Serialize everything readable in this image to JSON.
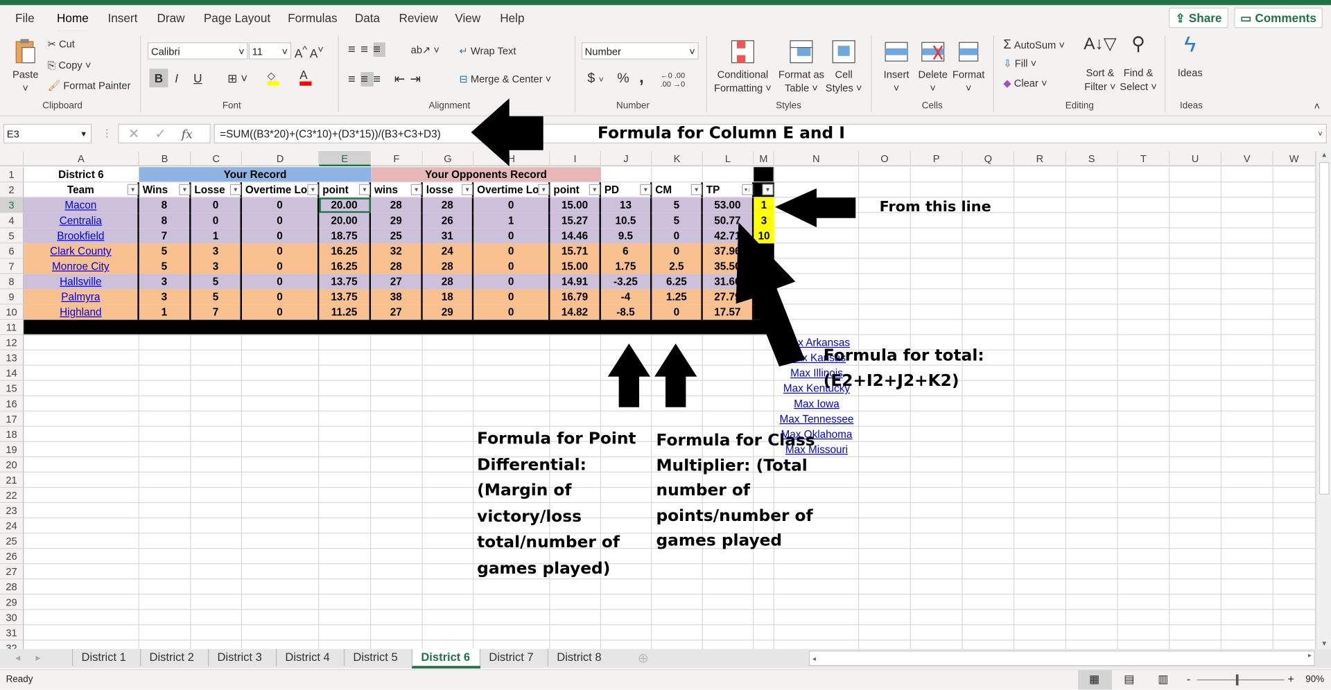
{
  "menu": {
    "tabs": [
      "File",
      "Home",
      "Insert",
      "Draw",
      "Page Layout",
      "Formulas",
      "Data",
      "Review",
      "View",
      "Help"
    ],
    "active": "Home",
    "share": "Share",
    "comments": "Comments"
  },
  "ribbon": {
    "clipboard": {
      "label": "Clipboard",
      "paste": "Paste",
      "cut": "Cut",
      "copy": "Copy",
      "format_painter": "Format Painter"
    },
    "font": {
      "label": "Font",
      "name": "Calibri",
      "size": "11",
      "bold": "B",
      "italic": "I",
      "underline": "U"
    },
    "alignment": {
      "label": "Alignment",
      "wrap": "Wrap Text",
      "merge": "Merge & Center"
    },
    "number": {
      "label": "Number",
      "format": "Number",
      "currency": "$",
      "percent": "%",
      "comma": ","
    },
    "styles": {
      "label": "Styles",
      "conditional": [
        "Conditional",
        "Formatting"
      ],
      "table": [
        "Format as",
        "Table"
      ],
      "cell": [
        "Cell",
        "Styles"
      ]
    },
    "cells": {
      "label": "Cells",
      "insert": "Insert",
      "delete": "Delete",
      "format": "Format"
    },
    "editing": {
      "label": "Editing",
      "autosum": "AutoSum",
      "fill": "Fill",
      "clear": "Clear",
      "sort": [
        "Sort &",
        "Filter"
      ],
      "find": [
        "Find &",
        "Select"
      ]
    },
    "ideas": {
      "label": "Ideas",
      "ideas": "Ideas"
    },
    "colors": {
      "highlight": "#ffff00",
      "font_color": "#ff0000"
    }
  },
  "formula_bar": {
    "name_box": "E3",
    "fx": "fx",
    "formula": "=SUM((B3*20)+(C3*10)+(D3*15))/(B3+C3+D3)"
  },
  "sheet": {
    "columns": [
      "A",
      "B",
      "C",
      "D",
      "E",
      "F",
      "G",
      "H",
      "I",
      "J",
      "K",
      "L",
      "M",
      "N",
      "O",
      "P",
      "Q",
      "R",
      "S",
      "T",
      "U",
      "V",
      "W"
    ],
    "selected_cell": "E3",
    "row_count": 32,
    "rows": [
      [
        "District 6",
        "Your Record",
        "",
        "",
        "",
        "Your Opponents Record",
        "",
        "",
        "",
        "",
        "",
        "",
        ""
      ],
      [
        "Team",
        "Wins",
        "Losse",
        "Overtime Lo",
        "point",
        "wins",
        "losse",
        "Overtime Lo",
        "point",
        "PD",
        "CM",
        "TP",
        ""
      ],
      [
        "Macon",
        "8",
        "0",
        "0",
        "20.00",
        "28",
        "28",
        "0",
        "15.00",
        "13",
        "5",
        "53.00",
        "1"
      ],
      [
        "Centralia",
        "8",
        "0",
        "0",
        "20.00",
        "29",
        "26",
        "1",
        "15.27",
        "10.5",
        "5",
        "50.77",
        "3"
      ],
      [
        "Brookfield",
        "7",
        "1",
        "0",
        "18.75",
        "25",
        "31",
        "0",
        "14.46",
        "9.5",
        "0",
        "42.71",
        "10"
      ],
      [
        "Clark County",
        "5",
        "3",
        "0",
        "16.25",
        "32",
        "24",
        "0",
        "15.71",
        "6",
        "0",
        "37.96",
        ""
      ],
      [
        "Monroe City",
        "5",
        "3",
        "0",
        "16.25",
        "28",
        "28",
        "0",
        "15.00",
        "1.75",
        "2.5",
        "35.50",
        ""
      ],
      [
        "Hallsville",
        "3",
        "5",
        "0",
        "13.75",
        "27",
        "28",
        "0",
        "14.91",
        "-3.25",
        "6.25",
        "31.66",
        ""
      ],
      [
        "Palmyra",
        "3",
        "5",
        "0",
        "13.75",
        "38",
        "18",
        "0",
        "16.79",
        "-4",
        "1.25",
        "27.79",
        ""
      ],
      [
        "Highland",
        "1",
        "7",
        "0",
        "11.25",
        "27",
        "29",
        "0",
        "14.82",
        "-8.5",
        "0",
        "17.57",
        ""
      ]
    ],
    "row_colors": [
      "",
      "",
      "#ccc0da",
      "#ccc0da",
      "#ccc0da",
      "#f9c090",
      "#f9c090",
      "#ccc0da",
      "#f9c090",
      "#f9c090"
    ],
    "header_colors": {
      "your_record": "#8db4e2",
      "opponents": "#e6b8b7",
      "rank": "#ffff00"
    },
    "links": [
      "Max Arkansas",
      "Max Kansas",
      "Max Illinois",
      "Max Kentucky",
      "Max Iowa",
      "Max Tennessee",
      "Max Oklahoma",
      "Max Missouri"
    ]
  },
  "annotations": {
    "formula_e_i": "Formula for Column E and I",
    "from_line": "From this line",
    "total": [
      "Formula for total:",
      "(E2+I2+J2+K2)"
    ],
    "pd": [
      "Formula for Point",
      "Differential:",
      "(Margin of",
      "victory/loss",
      "total/number of",
      "games played)"
    ],
    "cm": [
      "Formula for Class",
      "Multiplier:  (Total",
      "number of",
      "points/number of",
      "games played"
    ]
  },
  "sheet_tabs": {
    "tabs": [
      "District 1",
      "District 2",
      "District 3",
      "District 4",
      "District 5",
      "District 6",
      "District 7",
      "District 8"
    ],
    "active": "District 6"
  },
  "status": {
    "ready": "Ready",
    "zoom": "90%",
    "zoom_minus": "-",
    "zoom_plus": "+"
  }
}
